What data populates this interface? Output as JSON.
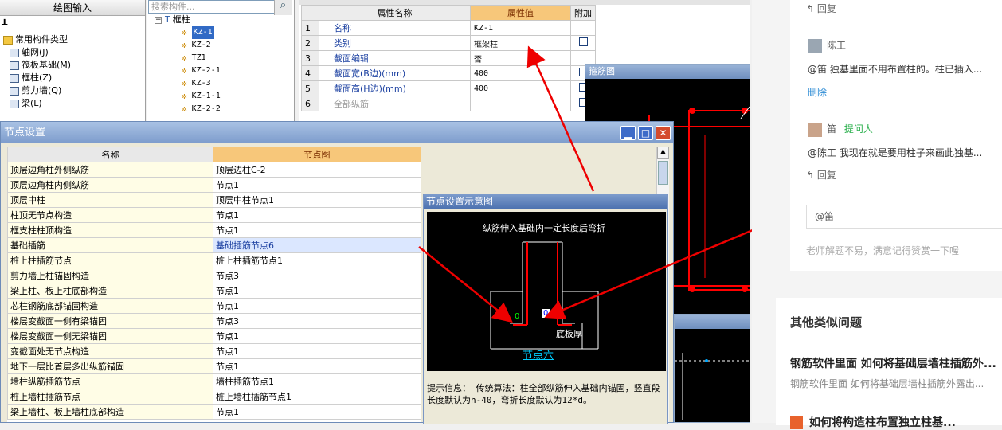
{
  "leftnav": {
    "title": "绘图输入",
    "items": [
      "常用构件类型",
      "轴网(J)",
      "筏板基础(M)",
      "框柱(Z)",
      "剪力墙(Q)",
      "梁(L)"
    ]
  },
  "tree": {
    "placeholder": "搜索构件...",
    "root": "框柱",
    "items": [
      "KZ-1",
      "KZ-2",
      "TZ1",
      "KZ-2-1",
      "KZ-3",
      "KZ-1-1",
      "KZ-2-2"
    ]
  },
  "props": {
    "col_name": "属性名称",
    "col_value": "属性值",
    "col_extra": "附加",
    "rows": [
      {
        "n": "1",
        "name": "名称",
        "value": "KZ-1",
        "cb": false
      },
      {
        "n": "2",
        "name": "类别",
        "value": "框架柱",
        "cb": true
      },
      {
        "n": "3",
        "name": "截面编辑",
        "value": "否",
        "cb": false
      },
      {
        "n": "4",
        "name": "截面宽(B边)(mm)",
        "value": "400",
        "cb": true
      },
      {
        "n": "5",
        "name": "截面高(H边)(mm)",
        "value": "400",
        "cb": true
      },
      {
        "n": "6",
        "name": "全部纵筋",
        "value": "",
        "cb": true
      }
    ]
  },
  "stirrup": {
    "title": "箍筋图"
  },
  "node": {
    "title": "节点设置",
    "col_name": "名称",
    "col_node": "节点图",
    "rows": [
      {
        "name": "顶层边角柱外侧纵筋",
        "node": "顶层边柱C-2"
      },
      {
        "name": "顶层边角柱内侧纵筋",
        "node": "节点1"
      },
      {
        "name": "顶层中柱",
        "node": "顶层中柱节点1"
      },
      {
        "name": "柱顶无节点构造",
        "node": "节点1"
      },
      {
        "name": "框支柱柱顶构造",
        "node": "节点1"
      },
      {
        "name": "基础插筋",
        "node": "基础插筋节点6"
      },
      {
        "name": "桩上柱插筋节点",
        "node": "桩上柱插筋节点1"
      },
      {
        "name": "剪力墙上柱锚固构造",
        "node": "节点3"
      },
      {
        "name": "梁上柱、板上柱底部构造",
        "node": "节点1"
      },
      {
        "name": "芯柱钢筋底部锚固构造",
        "node": "节点1"
      },
      {
        "name": "楼层变截面一侧有梁锚固",
        "node": "节点3"
      },
      {
        "name": "楼层变截面一侧无梁锚固",
        "node": "节点1"
      },
      {
        "name": "变截面处无节点构造",
        "node": "节点1"
      },
      {
        "name": "地下一层比首层多出纵筋锚固",
        "node": "节点1"
      },
      {
        "name": "墙柱纵筋插筋节点",
        "node": "墙柱插筋节点1"
      },
      {
        "name": "桩上墙柱插筋节点",
        "node": "桩上墙柱插筋节点1"
      },
      {
        "name": "梁上墙柱、板上墙柱底部构造",
        "node": "节点1"
      }
    ]
  },
  "schematic": {
    "title": "节点设置示意图",
    "caption": "纵筋伸入基础内一定长度后弯折",
    "node_label": "节点六",
    "slab": "底板厚",
    "v0": "0",
    "v1": "0",
    "tip_label": "提示信息：",
    "tip": "传统算法：柱全部纵筋伸入基础内锚固，竖直段长度默认为h-40，弯折长度默认为12*d。"
  },
  "web": {
    "reply": "回复",
    "user1": "陈工",
    "comment1": "@笛 独基里面不用布置柱的。柱已插入...",
    "delete": "删除",
    "user2": "笛",
    "asker": "提问人",
    "comment2": "@陈工 我现在就是要用柱子来画此独基...",
    "input": "@笛",
    "note": "老师解题不易，满意记得赞赏一下喔",
    "similar": "其他类似问题",
    "q1": "钢筋软件里面 如何将基础层墙柱插筋外...",
    "q1sub": "钢筋软件里面 如何将基础层墙柱插筋外露出...",
    "q2": "如何将构造柱布置独立柱基..."
  }
}
